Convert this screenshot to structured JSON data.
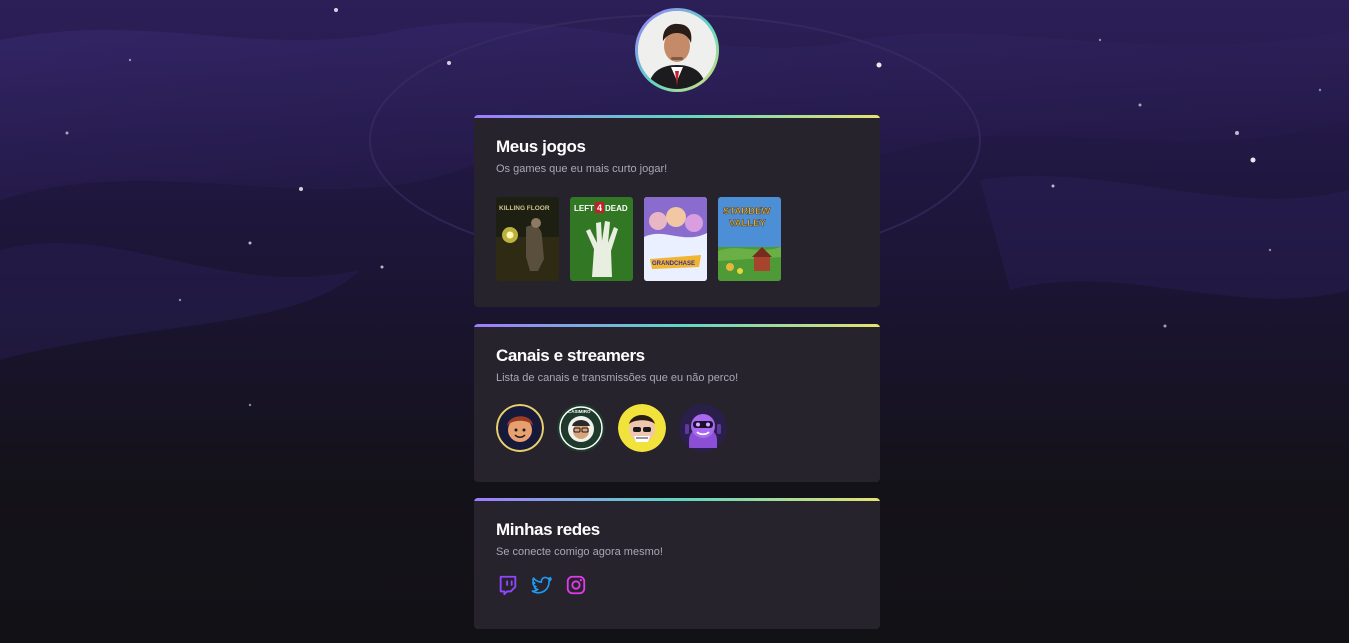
{
  "profile": {
    "avatar_alt": "profile-photo"
  },
  "sections": {
    "games": {
      "title": "Meus jogos",
      "subtitle": "Os games que eu mais curto jogar!",
      "items": [
        {
          "name": "Killing Floor",
          "cover_text": "KILLING FLOOR"
        },
        {
          "name": "Left 4 Dead",
          "cover_text_a": "LEFT",
          "cover_text_b": "4",
          "cover_text_c": "DEAD"
        },
        {
          "name": "GrandChase",
          "cover_text": "GRANDCHASE"
        },
        {
          "name": "Stardew Valley",
          "cover_text_a": "STARDEW",
          "cover_text_b": "VALLEY"
        }
      ]
    },
    "channels": {
      "title": "Canais e streamers",
      "subtitle": "Lista de canais e transmissões que eu não perco!",
      "items": [
        {
          "name": "streamer-1"
        },
        {
          "name": "casimiro",
          "ring_text": "CASIMIRO"
        },
        {
          "name": "streamer-3"
        },
        {
          "name": "streamer-4"
        }
      ]
    },
    "socials": {
      "title": "Minhas redes",
      "subtitle": "Se conecte comigo agora mesmo!",
      "items": [
        {
          "name": "twitch",
          "icon": "twitch-icon",
          "color": "#9146ff"
        },
        {
          "name": "twitter",
          "icon": "twitter-icon",
          "color": "#1d9bf0"
        },
        {
          "name": "instagram",
          "icon": "instagram-icon",
          "color": "#e23ae8"
        }
      ]
    }
  },
  "colors": {
    "gradient_start": "#9f7bff",
    "gradient_mid": "#5fd6c4",
    "gradient_end": "#e6e270",
    "card_bg": "#26232d",
    "subtitle": "#a8a8b3"
  }
}
